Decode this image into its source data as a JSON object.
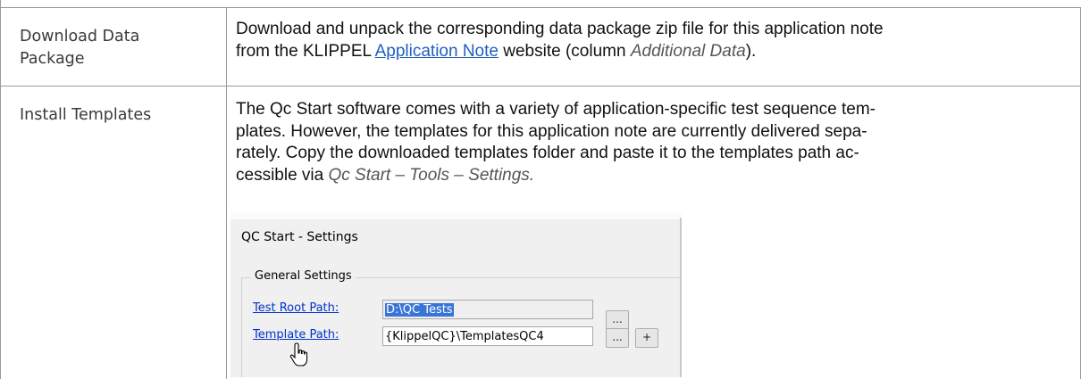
{
  "rows": [
    {
      "label": "Download Data\nPackage",
      "label_lines": [
        "Download Data",
        "Package"
      ],
      "lines": {
        "l1": "Download and unpack the corresponding data package zip file for this application note",
        "l2_a": "from the KLIPPEL ",
        "l2_link": "Application Note",
        "l2_b": " website (column ",
        "l2_em": "Additional Data",
        "l2_c": ")."
      }
    },
    {
      "label": "Install Templates",
      "lines": {
        "l1": "The Qc Start software comes with a variety of application-specific test sequence tem-",
        "l2": "plates. However, the templates for this application note are currently delivered sepa-",
        "l3": "rately. Copy the downloaded templates folder and paste it to the templates path ac-",
        "l4_a": "cessible via ",
        "l4_em": "Qc Start – Tools – Settings."
      }
    }
  ],
  "screenshot": {
    "window_title": "QC Start - Settings",
    "group_label": "General Settings",
    "test_root_label": "Test Root Path:",
    "test_root_value": "D:\\QC Tests",
    "template_label": "Template Path:",
    "template_value": "{KlippelQC}\\TemplatesQC4",
    "browse_label": "...",
    "add_label": "+",
    "cursor_icon": "hand-pointer-icon"
  }
}
